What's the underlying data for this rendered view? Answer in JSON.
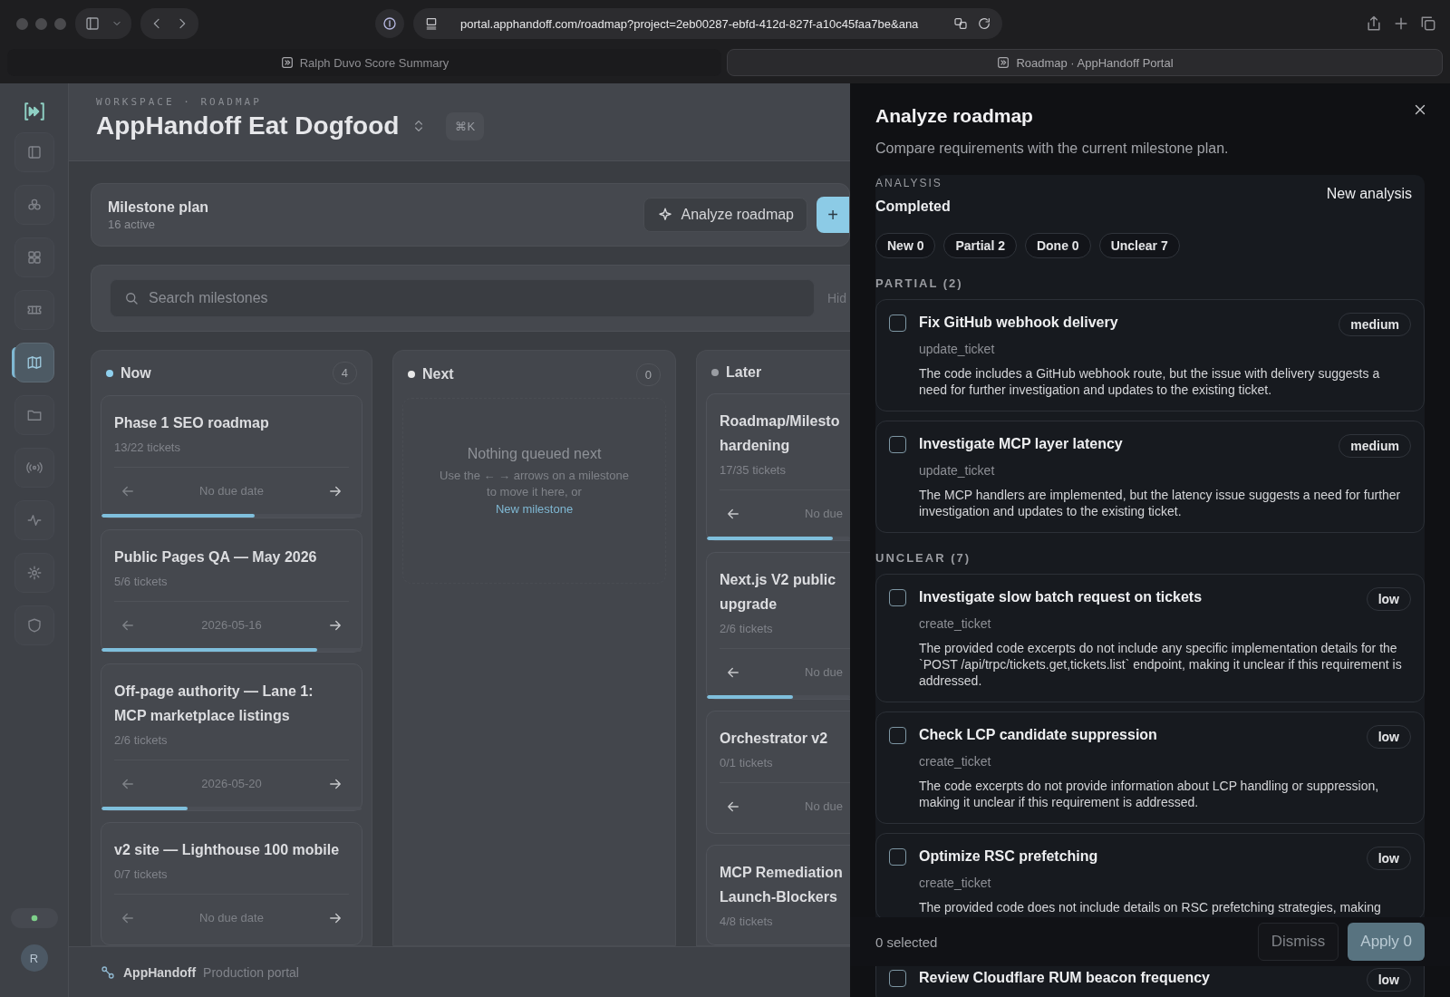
{
  "browser": {
    "url": "portal.apphandoff.com/roadmap?project=2eb00287-ebfd-412d-827f-a10c45faa7be&ana",
    "tabs": [
      {
        "title": "Ralph Duvo Score Summary",
        "selected": false
      },
      {
        "title": "Roadmap · AppHandoff Portal",
        "selected": true
      }
    ]
  },
  "sidebar": {
    "items": [
      {
        "selected": false
      },
      {
        "selected": false
      },
      {
        "selected": false
      },
      {
        "selected": false
      },
      {
        "selected": true
      },
      {
        "selected": false
      },
      {
        "selected": false
      },
      {
        "selected": false
      },
      {
        "selected": false
      },
      {
        "selected": false
      }
    ],
    "avatar": "R"
  },
  "header": {
    "breadcrumb": "WORKSPACE · ROADMAP",
    "title": "AppHandoff Eat Dogfood",
    "shortcut": "⌘K"
  },
  "plan": {
    "title": "Milestone plan",
    "subtitle": "16 active",
    "analyze_button": "Analyze roadmap",
    "add_button": "+"
  },
  "search": {
    "placeholder": "Search milestones",
    "side_text": "Hid"
  },
  "columns": [
    {
      "name": "Now",
      "count": "4",
      "color": "#8fd0ee",
      "cards": [
        {
          "title_lines": [
            "Phase 1 SEO roadmap"
          ],
          "tickets": "13/22 tickets",
          "due": "No due date",
          "next_arrow": true,
          "level": 0.59
        },
        {
          "title_lines": [
            "Public Pages QA — May 2026"
          ],
          "tickets": "5/6 tickets",
          "due": "2026-05-16",
          "next_arrow": true,
          "level": 0.83
        },
        {
          "title_lines": [
            "Off-page authority — Lane 1:",
            "MCP marketplace listings"
          ],
          "tickets": "2/6 tickets",
          "due": "2026-05-20",
          "next_arrow": true,
          "level": 0.33
        },
        {
          "title_lines": [
            "v2 site — Lighthouse 100 mobile"
          ],
          "tickets": "0/7 tickets",
          "due": "No due date",
          "next_arrow": true
        }
      ]
    },
    {
      "name": "Next",
      "count": "0",
      "color": "#e8e8e8",
      "empty": {
        "title": "Nothing queued next",
        "text": "Use the ← → arrows on a milestone to move it here, or",
        "link": "New milestone"
      }
    },
    {
      "name": "Later",
      "color": "#9a9da3",
      "cards": [
        {
          "title_lines": [
            "Roadmap/Milesto",
            "hardening"
          ],
          "tickets": "17/35 tickets",
          "due": "No due",
          "next_arrow": false,
          "level": 0.88
        },
        {
          "title_lines": [
            "Next.js V2 public",
            "upgrade"
          ],
          "tickets": "2/6 tickets",
          "due": "No due",
          "next_arrow": false,
          "level": 0.6
        },
        {
          "title_lines": [
            "Orchestrator v2"
          ],
          "tickets": "0/1 tickets",
          "due": "No due",
          "next_arrow": false
        },
        {
          "title_lines": [
            "MCP Remediation",
            "Launch-Blockers"
          ],
          "tickets": "4/8 tickets"
        }
      ]
    }
  ],
  "footer": {
    "brand": "AppHandoff",
    "subtitle": "Production portal"
  },
  "drawer": {
    "title": "Analyze roadmap",
    "subtitle": "Compare requirements with the current milestone plan.",
    "analysis_label": "ANALYSIS",
    "status": "Completed",
    "new_analysis": "New analysis",
    "chips": [
      "New 0",
      "Partial 2",
      "Done 0",
      "Unclear 7"
    ],
    "sections": [
      {
        "heading": "PARTIAL (2)",
        "items": [
          {
            "checked": false,
            "title": "Fix GitHub webhook delivery",
            "action": "update_ticket",
            "priority": "medium",
            "description": "The code includes a GitHub webhook route, but the issue with delivery suggests a need for further investigation and updates to the existing ticket."
          },
          {
            "checked": false,
            "title": "Investigate MCP layer latency",
            "action": "update_ticket",
            "priority": "medium",
            "description": "The MCP handlers are implemented, but the latency issue suggests a need for further investigation and updates to the existing ticket."
          }
        ]
      },
      {
        "heading": "UNCLEAR (7)",
        "items": [
          {
            "checked": false,
            "title": "Investigate slow batch request on tickets",
            "action": "create_ticket",
            "priority": "low",
            "description": "The provided code excerpts do not include any specific implementation details for the `POST /api/trpc/tickets.get,tickets.list` endpoint, making it unclear if this requirement is addressed."
          },
          {
            "checked": false,
            "title": "Check LCP candidate suppression",
            "action": "create_ticket",
            "priority": "low",
            "description": "The code excerpts do not provide information about LCP handling or suppression, making it unclear if this requirement is addressed."
          },
          {
            "checked": false,
            "title": "Optimize RSC prefetching",
            "action": "create_ticket",
            "priority": "low",
            "description": "The provided code does not include details on RSC prefetching strategies, making"
          },
          {
            "checked": false,
            "title": "Review Cloudflare RUM beacon frequency",
            "priority": "low"
          }
        ]
      }
    ],
    "selected_count": "0 selected",
    "dismiss": "Dismiss",
    "apply": "Apply 0"
  }
}
